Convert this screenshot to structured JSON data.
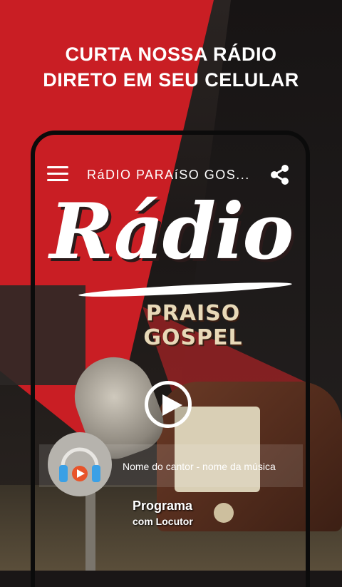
{
  "promo": {
    "line1": "CURTA NOSSA RÁDIO",
    "line2": "DIRETO EM SEU CELULAR"
  },
  "app_bar": {
    "title": "RáDIO PARAíSO GOS...",
    "menu_icon": "hamburger-menu-icon",
    "share_icon": "share-icon"
  },
  "logo": {
    "script": "Rádio",
    "line1": "PRAISO",
    "line2": "GOSPEL"
  },
  "player": {
    "play_icon": "play-icon",
    "now_playing": "Nome do cantor - nome da música",
    "program": "Programa",
    "announcer": "com Locutor",
    "avatar_icon": "headphones-icon"
  },
  "colors": {
    "brand_red": "#c91e24",
    "headphone_blue": "#3aa0e6",
    "headphone_play": "#e8542a"
  }
}
